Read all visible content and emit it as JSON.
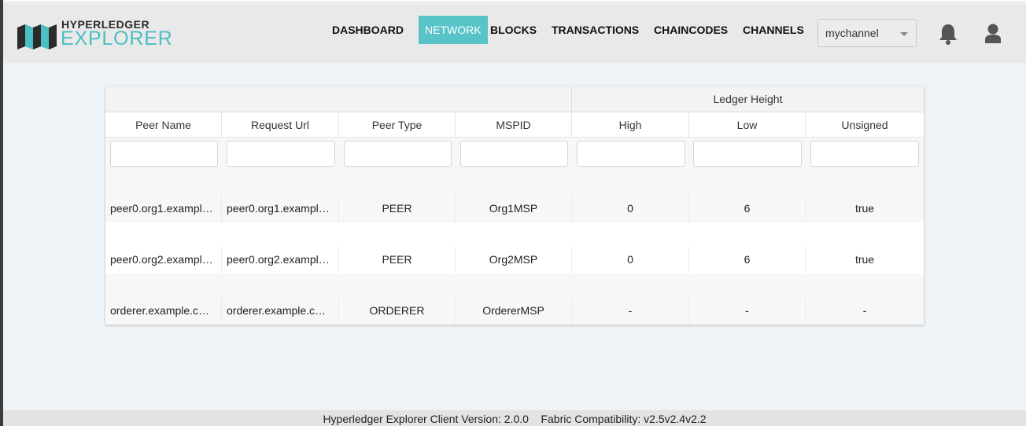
{
  "brand": {
    "line1": "HYPERLEDGER",
    "line2": "EXPLORER",
    "accent_color": "#4bbfc4"
  },
  "nav": {
    "items": [
      {
        "label": "DASHBOARD",
        "active": false
      },
      {
        "label": "NETWORK",
        "active": true
      },
      {
        "label": "BLOCKS",
        "active": false
      },
      {
        "label": "TRANSACTIONS",
        "active": false
      },
      {
        "label": "CHAINCODES",
        "active": false
      },
      {
        "label": "CHANNELS",
        "active": false
      }
    ],
    "channel_selected": "mychannel",
    "bell_icon": "bell-icon",
    "user_icon": "user-icon"
  },
  "table": {
    "group_header": "Ledger Height",
    "columns": [
      "Peer Name",
      "Request Url",
      "Peer Type",
      "MSPID",
      "High",
      "Low",
      "Unsigned"
    ],
    "rows": [
      [
        "peer0.org1.exampl…",
        "peer0.org1.exampl…",
        "PEER",
        "Org1MSP",
        "0",
        "6",
        "true"
      ],
      [
        "peer0.org2.exampl…",
        "peer0.org2.exampl…",
        "PEER",
        "Org2MSP",
        "0",
        "6",
        "true"
      ],
      [
        "orderer.example.c…",
        "orderer.example.c…",
        "ORDERER",
        "OrdererMSP",
        "-",
        "-",
        "-"
      ]
    ]
  },
  "footer": {
    "text": "Hyperledger Explorer Client Version: 2.0.0    Fabric Compatibility: v2.5v2.4v2.2"
  }
}
